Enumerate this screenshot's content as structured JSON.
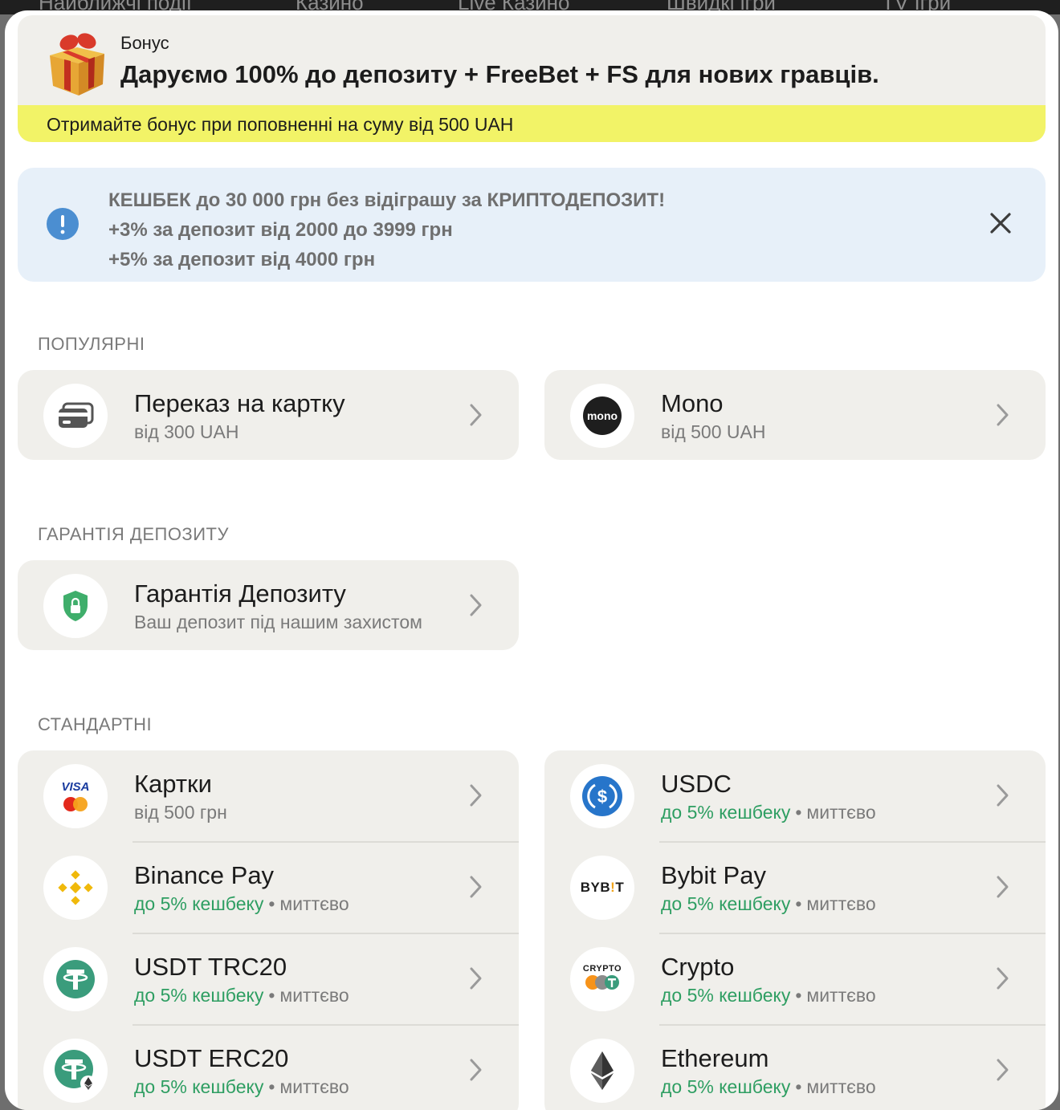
{
  "background_nav": {
    "items": [
      "Найближчі події",
      "Казино",
      "Live Казино",
      "Швидкі ігри",
      "TV Ігри"
    ]
  },
  "bonus": {
    "label": "Бонус",
    "title": "Даруємо 100% до депозиту + FreeBet + FS для нових гравців.",
    "strip": "Отримайте бонус при поповненні на суму від 500 UAH",
    "icon": "gift-box-icon"
  },
  "cashback": {
    "lines": [
      "КЕШБЕК до 30 000 грн без відіграшу за КРИПТОДЕПОЗИТ!",
      "+3% за депозит від 2000 до 3999 грн",
      "+5% за депозит від 4000 грн"
    ],
    "icon": "info-exclamation-icon",
    "close_icon": "close-icon",
    "icon_color": "#4b8ed1"
  },
  "sections": {
    "popular": {
      "title": "ПОПУЛЯРНІ",
      "items": [
        {
          "title": "Переказ на картку",
          "sub": "від 300 UAH",
          "icon": "card-transfer-icon"
        },
        {
          "title": "Mono",
          "sub": "від 500 UAH",
          "icon": "mono-logo-icon",
          "logo_text": "mono"
        }
      ]
    },
    "guarantee": {
      "title": "ГАРАНТІЯ ДЕПОЗИТУ",
      "items": [
        {
          "title": "Гарантія Депозиту",
          "sub": "Ваш депозит під нашим захистом",
          "icon": "shield-lock-icon"
        }
      ]
    },
    "standard": {
      "title": "СТАНДАРТНІ",
      "cashback_text": "до 5% кешбеку",
      "dot": "•",
      "instant_text": "миттєво",
      "left": [
        {
          "title": "Картки",
          "sub": "від 500 грн",
          "icon": "visa-mastercard-icon",
          "logo_text": "VISA"
        },
        {
          "title": "Binance Pay",
          "icon": "binance-icon"
        },
        {
          "title": "USDT TRC20",
          "icon": "tether-icon"
        },
        {
          "title": "USDT ERC20",
          "icon": "tether-erc20-icon"
        }
      ],
      "right": [
        {
          "title": "USDC",
          "icon": "usdc-icon"
        },
        {
          "title": "Bybit Pay",
          "icon": "bybit-icon",
          "logo_text_a": "BYB",
          "logo_text_b": "!",
          "logo_text_c": "T"
        },
        {
          "title": "Crypto",
          "icon": "crypto-icon",
          "logo_text": "CRYPTO"
        },
        {
          "title": "Ethereum",
          "icon": "ethereum-icon"
        }
      ]
    }
  },
  "colors": {
    "accent_green": "#2e9e62",
    "bonus_strip": "#f2f367",
    "card_bg": "#f0efeb",
    "cashback_bg": "#e7f0f9"
  }
}
